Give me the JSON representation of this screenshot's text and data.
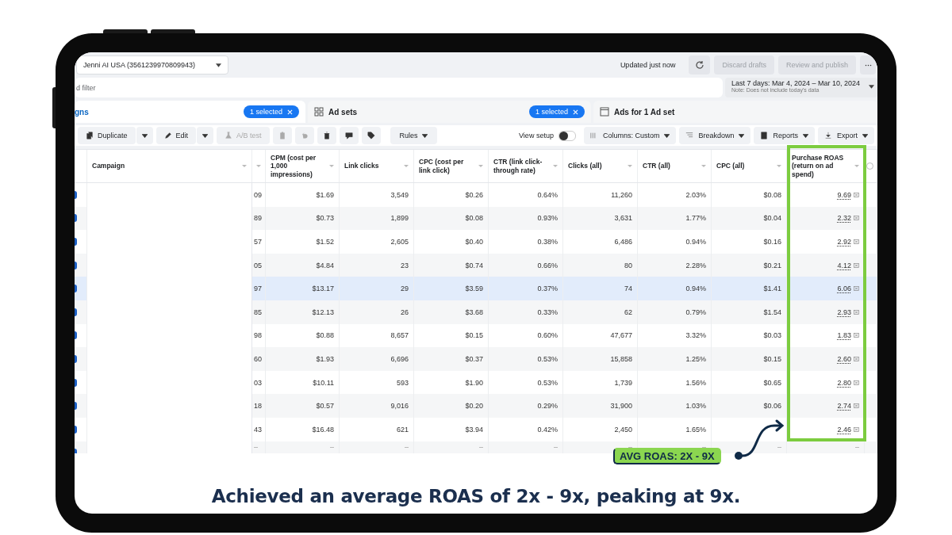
{
  "account": {
    "label": "Jenni AI USA (3561239970809943)"
  },
  "status": "Updated just now",
  "header_buttons": [
    {
      "label": "Discard drafts",
      "disabled": true
    },
    {
      "label": "Review and publish",
      "disabled": true
    }
  ],
  "search": {
    "placeholder": "d filter"
  },
  "date_range": {
    "label": "Last 7 days: Mar 4, 2024 – Mar 10, 2024",
    "note": "Note: Does not include today's data"
  },
  "tabs": [
    {
      "kind": "campaigns",
      "label": "gns",
      "selected": true,
      "badge": "1 selected"
    },
    {
      "kind": "ad_sets",
      "label": "Ad sets",
      "selected": false,
      "badge": "1 selected"
    },
    {
      "kind": "ads",
      "label": "Ads for 1 Ad set",
      "selected": false
    }
  ],
  "toolbar": [
    {
      "kind": "split",
      "label": "Duplicate",
      "disabled": false
    },
    {
      "kind": "split",
      "label": "Edit",
      "disabled": false
    },
    {
      "kind": "button",
      "label": "A/B test",
      "disabled": true
    },
    {
      "kind": "icon",
      "disabled": true
    },
    {
      "kind": "icon",
      "disabled": true
    },
    {
      "kind": "icon",
      "disabled": false
    },
    {
      "kind": "icon",
      "disabled": false
    },
    {
      "kind": "icon",
      "disabled": false
    },
    {
      "kind": "menu",
      "label": "Rules",
      "disabled": false
    }
  ],
  "view_setup": {
    "label": "View setup",
    "on": false
  },
  "toolbar_right": [
    {
      "label": "Columns: Custom"
    },
    {
      "label": "Breakdown"
    },
    {
      "label": "Reports"
    },
    {
      "label": "Export"
    }
  ],
  "table": {
    "columns": [
      {
        "label": "Campaign"
      },
      {
        "label": "CPM (cost per 1,000 impressions)"
      },
      {
        "label": "Link clicks"
      },
      {
        "label": "CPC (cost per link click)"
      },
      {
        "label": "CTR (link click-through rate)"
      },
      {
        "label": "Clicks (all)"
      },
      {
        "label": "CTR (all)"
      },
      {
        "label": "CPC (all)"
      },
      {
        "label": "Purchase ROAS (return on ad spend)"
      }
    ],
    "rows": [
      {
        "kind": "data",
        "selected": false,
        "cells": [
          "09",
          "$1.69",
          "3,549",
          "$0.26",
          "0.64%",
          "11,260",
          "2.03%",
          "$0.08",
          "9.69"
        ]
      },
      {
        "kind": "data",
        "selected": false,
        "cells": [
          "89",
          "$0.73",
          "1,899",
          "$0.08",
          "0.93%",
          "3,631",
          "1.77%",
          "$0.04",
          "2.32"
        ]
      },
      {
        "kind": "data",
        "selected": false,
        "cells": [
          "57",
          "$1.52",
          "2,605",
          "$0.40",
          "0.38%",
          "6,486",
          "0.94%",
          "$0.16",
          "2.92"
        ]
      },
      {
        "kind": "data",
        "selected": false,
        "cells": [
          "05",
          "$4.84",
          "23",
          "$0.74",
          "0.66%",
          "80",
          "2.28%",
          "$0.21",
          "4.12"
        ]
      },
      {
        "kind": "data",
        "selected": true,
        "cells": [
          "97",
          "$13.17",
          "29",
          "$3.59",
          "0.37%",
          "74",
          "0.94%",
          "$1.41",
          "6.06"
        ]
      },
      {
        "kind": "data",
        "selected": false,
        "cells": [
          "85",
          "$12.13",
          "26",
          "$3.68",
          "0.33%",
          "62",
          "0.79%",
          "$1.54",
          "2.93"
        ]
      },
      {
        "kind": "data",
        "selected": false,
        "cells": [
          "98",
          "$0.88",
          "8,657",
          "$0.15",
          "0.60%",
          "47,677",
          "3.32%",
          "$0.03",
          "1.83"
        ]
      },
      {
        "kind": "data",
        "selected": false,
        "cells": [
          "60",
          "$1.93",
          "6,696",
          "$0.37",
          "0.53%",
          "15,858",
          "1.25%",
          "$0.15",
          "2.60"
        ]
      },
      {
        "kind": "data",
        "selected": false,
        "cells": [
          "03",
          "$10.11",
          "593",
          "$1.90",
          "0.53%",
          "1,739",
          "1.56%",
          "$0.65",
          "2.80"
        ]
      },
      {
        "kind": "data",
        "selected": false,
        "cells": [
          "18",
          "$0.57",
          "9,016",
          "$0.20",
          "0.29%",
          "31,900",
          "1.03%",
          "$0.06",
          "2.74"
        ]
      },
      {
        "kind": "data",
        "selected": false,
        "cells": [
          "43",
          "$16.48",
          "621",
          "$3.94",
          "0.42%",
          "2,450",
          "1.65%",
          null,
          "2.46"
        ]
      },
      {
        "kind": "empty",
        "selected": false,
        "cells": [
          "–",
          "–",
          "–",
          "–",
          "–",
          "–",
          "–",
          "–",
          "–"
        ]
      }
    ]
  },
  "annotation": {
    "label": "AVG ROAS: 2X - 9X"
  },
  "caption": "Achieved an average ROAS of 2x - 9x, peaking at 9x."
}
